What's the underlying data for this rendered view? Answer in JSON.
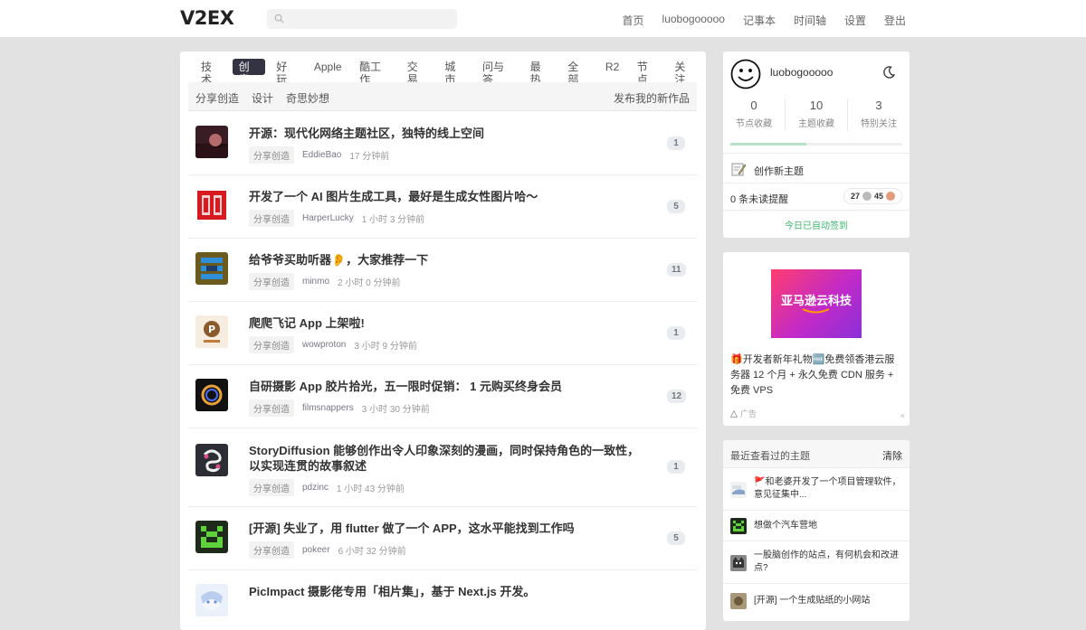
{
  "header": {
    "logo": "V2EX",
    "nav": [
      "首页",
      "luobogooooo",
      "记事本",
      "时间轴",
      "设置",
      "登出"
    ]
  },
  "tabs": [
    {
      "label": "技术",
      "active": false
    },
    {
      "label": "创意",
      "active": true
    },
    {
      "label": "好玩",
      "active": false
    },
    {
      "label": "Apple",
      "active": false
    },
    {
      "label": "酷工作",
      "active": false
    },
    {
      "label": "交易",
      "active": false
    },
    {
      "label": "城市",
      "active": false
    },
    {
      "label": "问与答",
      "active": false
    },
    {
      "label": "最热",
      "active": false
    },
    {
      "label": "全部",
      "active": false
    },
    {
      "label": "R2",
      "active": false
    },
    {
      "label": "节点",
      "active": false
    },
    {
      "label": "关注",
      "active": false
    }
  ],
  "subnav": {
    "links": [
      "分享创造",
      "设计",
      "奇思妙想"
    ],
    "publish": "发布我的新作品"
  },
  "topics": [
    {
      "title": "开源：现代化网络主题社区，独特的线上空间",
      "node": "分享创造",
      "author": "EddieBao",
      "time": "17 分钟前",
      "replies": "1",
      "avatar": "sunset"
    },
    {
      "title": "开发了一个 AI 图片生成工具，最好是生成女性图片哈～",
      "node": "分享创造",
      "author": "HarperLucky",
      "time": "1 小时 3 分钟前",
      "replies": "5",
      "avatar": "red-seal"
    },
    {
      "title": "给爷爷买助听器👂，大家推荐一下",
      "node": "分享创造",
      "author": "minmo",
      "time": "2 小时 0 分钟前",
      "replies": "11",
      "avatar": "pixel-blue"
    },
    {
      "title": "爬爬飞记 App 上架啦!",
      "node": "分享创造",
      "author": "wowproton",
      "time": "3 小时 9 分钟前",
      "replies": "1",
      "avatar": "p-logo"
    },
    {
      "title": "自研摄影 App 胶片拾光，五一限时促销： 1 元购买终身会员",
      "node": "分享创造",
      "author": "filmsnappers",
      "time": "3 小时 30 分钟前",
      "replies": "12",
      "avatar": "ring"
    },
    {
      "title": "StoryDiffusion 能够创作出令人印象深刻的漫画，同时保持角色的一致性，以实现连贯的故事叙述",
      "node": "分享创造",
      "author": "pdzinc",
      "time": "1 小时 43 分钟前",
      "replies": "1",
      "avatar": "swirl"
    },
    {
      "title": "[开源] 失业了，用 flutter 做了一个 APP，这水平能找到工作吗",
      "node": "分享创造",
      "author": "pokeer",
      "time": "6 小时 32 分钟前",
      "replies": "5",
      "avatar": "pixel-green"
    },
    {
      "title": "PicImpact 摄影佬专用「相片集」，基于 Next.js 开发。",
      "node": "分享创造",
      "author": "",
      "time": "",
      "replies": "",
      "avatar": "anime"
    }
  ],
  "user": {
    "name": "luobogooooo",
    "stats": [
      {
        "num": "0",
        "label": "节点收藏"
      },
      {
        "num": "10",
        "label": "主题收藏"
      },
      {
        "num": "3",
        "label": "特别关注"
      }
    ],
    "progress": 0.44,
    "create": "创作新主题",
    "notify": "0 条未读提醒",
    "silver": "27",
    "bronze": "45",
    "checkin": "今日已自动签到"
  },
  "ad": {
    "image_text": "亚马逊云科技",
    "text": "🎁开发者新年礼物🆓免费领香港云服务器 12 个月 + 永久免费 CDN 服务 + 免费 VPS",
    "label": "广告",
    "close": "×"
  },
  "recent": {
    "title": "最近查看过的主题",
    "clear": "清除",
    "items": [
      {
        "text": "🚩和老婆开发了一个项目管理软件，意见征集中...",
        "avatar": "flag"
      },
      {
        "text": "想做个汽车营地",
        "avatar": "pixel-green"
      },
      {
        "text": "一股脑创作的站点，有何机会和改进点?",
        "avatar": "cat"
      },
      {
        "text": "[开源] 一个生成贴纸的小网站",
        "avatar": "pic"
      }
    ]
  },
  "colors": {
    "accent": "#334455",
    "checkin": "#3bb66d",
    "count_bg": "#e8ebf0"
  }
}
